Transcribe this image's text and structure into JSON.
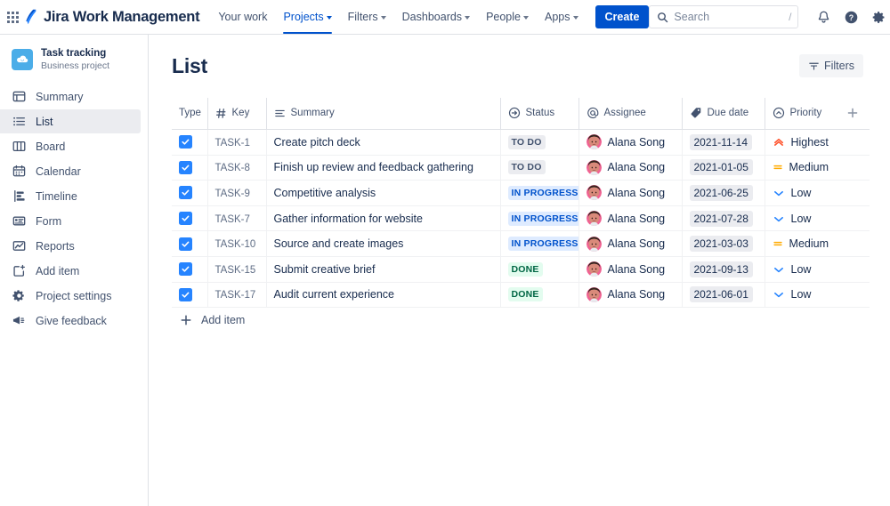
{
  "topnav": {
    "app_switcher_icon": "grid-apps-icon",
    "brand": "Jira Work Management",
    "items": [
      {
        "label": "Your work",
        "has_caret": false,
        "active": false
      },
      {
        "label": "Projects",
        "has_caret": true,
        "active": true
      },
      {
        "label": "Filters",
        "has_caret": true,
        "active": false
      },
      {
        "label": "Dashboards",
        "has_caret": true,
        "active": false
      },
      {
        "label": "People",
        "has_caret": true,
        "active": false
      },
      {
        "label": "Apps",
        "has_caret": true,
        "active": false
      }
    ],
    "create_label": "Create",
    "search": {
      "placeholder": "Search",
      "value": "",
      "shortcut": "/"
    },
    "icons": [
      "notifications-bell-icon",
      "help-icon",
      "settings-gear-icon",
      "account-avatar-icon"
    ]
  },
  "sidebar": {
    "project": {
      "name": "Task tracking",
      "type": "Business project",
      "avatar_icon": "cloud-avatar-icon"
    },
    "items": [
      {
        "label": "Summary",
        "icon": "summary-icon",
        "active": false
      },
      {
        "label": "List",
        "icon": "list-icon",
        "active": true
      },
      {
        "label": "Board",
        "icon": "board-icon",
        "active": false
      },
      {
        "label": "Calendar",
        "icon": "calendar-icon",
        "active": false
      },
      {
        "label": "Timeline",
        "icon": "timeline-icon",
        "active": false
      },
      {
        "label": "Form",
        "icon": "form-icon",
        "active": false
      },
      {
        "label": "Reports",
        "icon": "reports-icon",
        "active": false
      },
      {
        "label": "Add item",
        "icon": "add-item-icon",
        "active": false
      },
      {
        "label": "Project settings",
        "icon": "settings-gear-icon",
        "active": false
      },
      {
        "label": "Give feedback",
        "icon": "megaphone-icon",
        "active": false
      }
    ]
  },
  "main": {
    "title": "List",
    "filters_label": "Filters",
    "add_item_label": "Add item",
    "add_column_label": "+",
    "columns": [
      {
        "label": "Type",
        "icon": null
      },
      {
        "label": "Key",
        "icon": "hash-icon"
      },
      {
        "label": "Summary",
        "icon": "summary-lines-icon"
      },
      {
        "label": "Status",
        "icon": "status-arrow-icon"
      },
      {
        "label": "Assignee",
        "icon": "at-sign-icon"
      },
      {
        "label": "Due date",
        "icon": "tag-icon"
      },
      {
        "label": "Priority",
        "icon": "priority-circle-icon"
      }
    ],
    "rows": [
      {
        "type": "task",
        "key": "TASK-1",
        "summary": "Create pitch deck",
        "status": "TO DO",
        "status_kind": "todo",
        "assignee": "Alana Song",
        "due": "2021-11-14",
        "priority": "Highest",
        "priority_kind": "highest"
      },
      {
        "type": "task",
        "key": "TASK-8",
        "summary": "Finish up review and feedback gathering",
        "status": "TO DO",
        "status_kind": "todo",
        "assignee": "Alana Song",
        "due": "2021-01-05",
        "priority": "Medium",
        "priority_kind": "medium"
      },
      {
        "type": "task",
        "key": "TASK-9",
        "summary": "Competitive analysis",
        "status": "IN PROGRESS",
        "status_kind": "prog",
        "assignee": "Alana Song",
        "due": "2021-06-25",
        "priority": "Low",
        "priority_kind": "low"
      },
      {
        "type": "task",
        "key": "TASK-7",
        "summary": "Gather information for website",
        "status": "IN PROGRESS",
        "status_kind": "prog",
        "assignee": "Alana Song",
        "due": "2021-07-28",
        "priority": "Low",
        "priority_kind": "low"
      },
      {
        "type": "task",
        "key": "TASK-10",
        "summary": "Source and create images",
        "status": "IN PROGRESS",
        "status_kind": "prog",
        "assignee": "Alana Song",
        "due": "2021-03-03",
        "priority": "Medium",
        "priority_kind": "medium"
      },
      {
        "type": "task",
        "key": "TASK-15",
        "summary": "Submit creative brief",
        "status": "DONE",
        "status_kind": "done",
        "assignee": "Alana Song",
        "due": "2021-09-13",
        "priority": "Low",
        "priority_kind": "low"
      },
      {
        "type": "task",
        "key": "TASK-17",
        "summary": "Audit current experience",
        "status": "DONE",
        "status_kind": "done",
        "assignee": "Alana Song",
        "due": "2021-06-01",
        "priority": "Low",
        "priority_kind": "low"
      }
    ]
  },
  "colors": {
    "brand_blue": "#0052cc",
    "accent_blue": "#2684ff",
    "status_todo_bg": "#ebecf0",
    "status_progress_bg": "#deebff",
    "status_done_bg": "#e3fcef",
    "priority_highest": "#ff5630",
    "priority_medium": "#ffab00",
    "priority_low": "#2684ff",
    "text": "#172b4d",
    "subtle_text": "#6b778c",
    "border": "#dfe1e6"
  }
}
